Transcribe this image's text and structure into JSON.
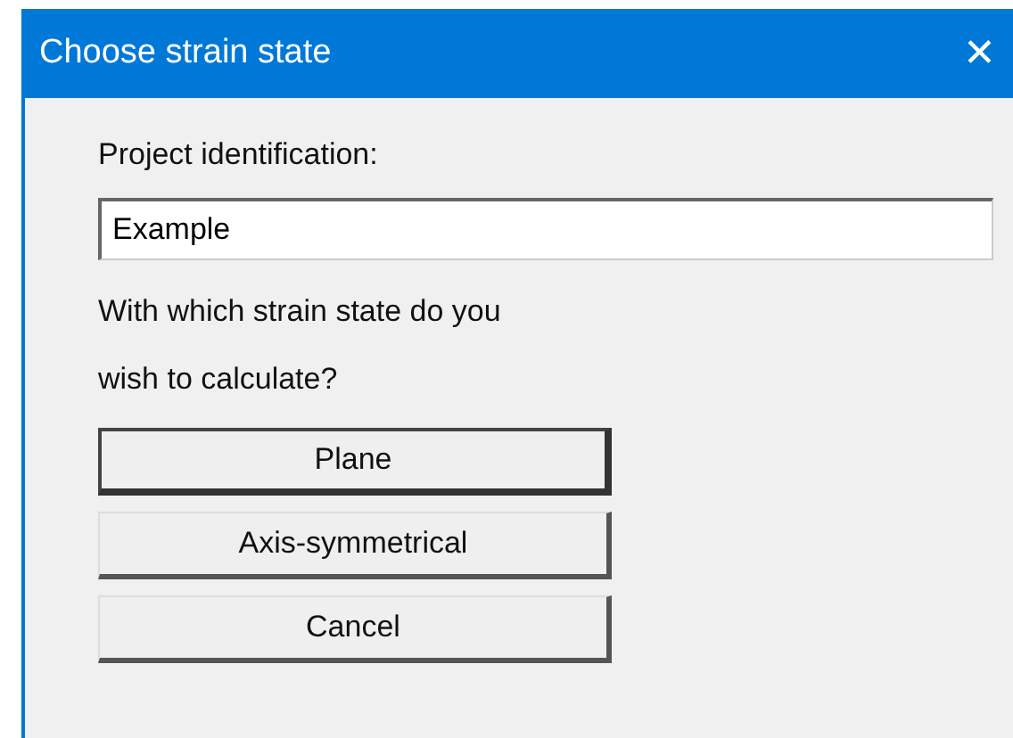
{
  "window": {
    "title": "Choose strain state",
    "close": "✕"
  },
  "project": {
    "label": "Project identification:",
    "value": "Example"
  },
  "question": "With which strain state do you wish to calculate?",
  "buttons": [
    {
      "label": "Plane",
      "default": true
    },
    {
      "label": "Axis-symmetrical",
      "default": false
    },
    {
      "label": "Cancel",
      "default": false
    }
  ]
}
